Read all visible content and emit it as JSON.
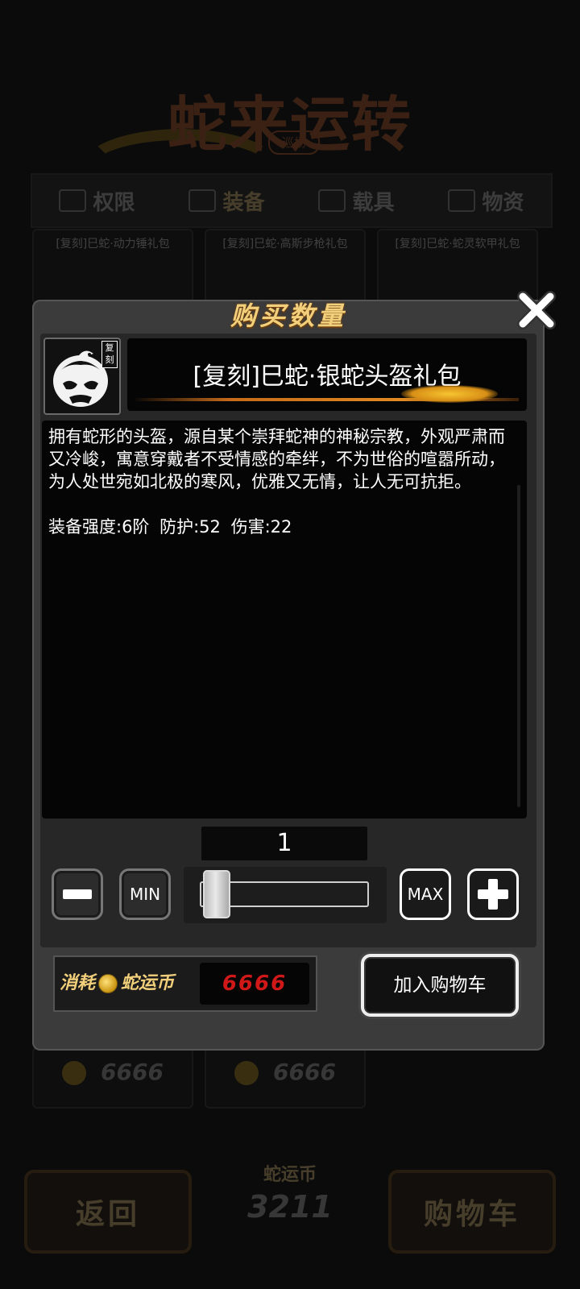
{
  "background": {
    "game_title": "蛇来运转",
    "game_title_sub": "巡场",
    "tabs": [
      {
        "label": "权限"
      },
      {
        "label": "装备"
      },
      {
        "label": "载具"
      },
      {
        "label": "物资"
      }
    ],
    "cards": [
      {
        "name": "[复刻]巳蛇·动力锤礼包",
        "price": "6666"
      },
      {
        "name": "[复刻]巳蛇·高斯步枪礼包",
        "price": "6666"
      },
      {
        "name": "[复刻]巳蛇·蛇灵软甲礼包",
        "price": ""
      }
    ],
    "bottom": {
      "back_label": "返回",
      "currency_label": "蛇运币",
      "currency_value": "3211",
      "cart_label": "购物车"
    }
  },
  "dialog": {
    "title": "购买数量",
    "item": {
      "badge": "复刻",
      "name": "[复刻]巳蛇·银蛇头盔礼包",
      "description": "拥有蛇形的头盔，源自某个崇拜蛇神的神秘宗教，外观严肃而又冷峻，寓意穿戴者不受情感的牵绊，不为世俗的喧嚣所动，为人处世宛如北极的寒风，优雅又无情，让人无可抗拒。",
      "stats": "装备强度:6阶  防护:52  伤害:22"
    },
    "quantity": "1",
    "quantity_fraction": 0.0,
    "controls": {
      "min_label": "MIN",
      "max_label": "MAX"
    },
    "cost": {
      "prefix": "消耗",
      "currency": "蛇运币",
      "value": "6666"
    },
    "add_to_cart_label": "加入购物车"
  },
  "icons": {
    "close": "close-icon",
    "minus": "minus-icon",
    "plus": "plus-icon",
    "coin": "coin-icon",
    "helmet": "helmet-icon"
  },
  "colors": {
    "title_gold": "#f2cf7a",
    "cost_red": "#d01818",
    "dialog_bg": "#3b3b3b"
  }
}
